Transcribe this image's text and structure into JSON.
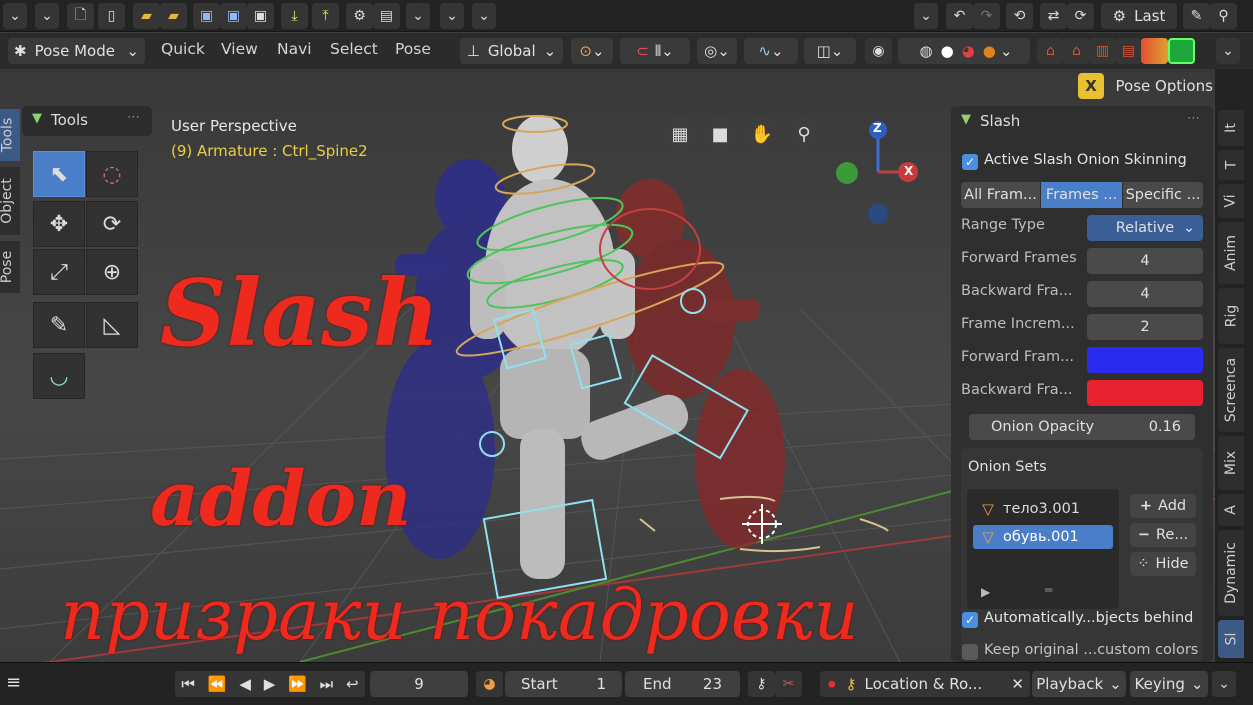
{
  "topbar": {
    "last_label": "Last"
  },
  "header": {
    "mode_label": "Pose Mode",
    "menus": [
      "Quick",
      "View",
      "Navi",
      "Select",
      "Pose"
    ],
    "orientation_label": "Global",
    "pose_options_label": "Pose Options"
  },
  "viewport": {
    "perspective_label": "User Perspective",
    "object_label": "(9) Armature : Ctrl_Spine2",
    "overlay_title": "Slash",
    "overlay_subtitle": "addon",
    "overlay_caption": "призраки покадровки",
    "gizmo_z": "Z",
    "gizmo_x": "X"
  },
  "tools_panel": {
    "title": "Tools"
  },
  "left_tabs": [
    "Tools",
    "Object",
    "Pose"
  ],
  "slash_panel": {
    "title": "Slash",
    "active_checkbox_label": "Active Slash Onion Skinning",
    "mode_tabs": [
      "All Fram...",
      "Frames ...",
      "Specific ..."
    ],
    "range_type_label": "Range Type",
    "range_type_value": "Relative",
    "forward_frames_label": "Forward Frames",
    "forward_frames_value": "4",
    "backward_frames_label": "Backward Fra...",
    "backward_frames_value": "4",
    "frame_increment_label": "Frame Increm...",
    "frame_increment_value": "2",
    "forward_color_label": "Forward Fram...",
    "backward_color_label": "Backward Fra...",
    "forward_color": "#2b2bf0",
    "backward_color": "#e8222e",
    "onion_opacity_label": "Onion Opacity",
    "onion_opacity_value": "0.16",
    "onion_sets_title": "Onion Sets",
    "onion_sets": [
      "тело3.001",
      "обувь.001"
    ],
    "add_label": "Add",
    "remove_label": "Re...",
    "hide_label": "Hide",
    "auto_checkbox_label": "Automatically...bjects behind",
    "keep_checkbox_label": "Keep original ...custom colors"
  },
  "right_tabs": [
    "It",
    "T",
    "Vi",
    "Anim",
    "Rig",
    "Screenca",
    "Mix",
    "A",
    "Dynamic",
    "Sl"
  ],
  "footer": {
    "current_frame": "9",
    "start_label": "Start",
    "start_value": "1",
    "end_label": "End",
    "end_value": "23",
    "keying_set_label": "Location & Ro...",
    "playback_label": "Playback",
    "keying_label": "Keying"
  }
}
